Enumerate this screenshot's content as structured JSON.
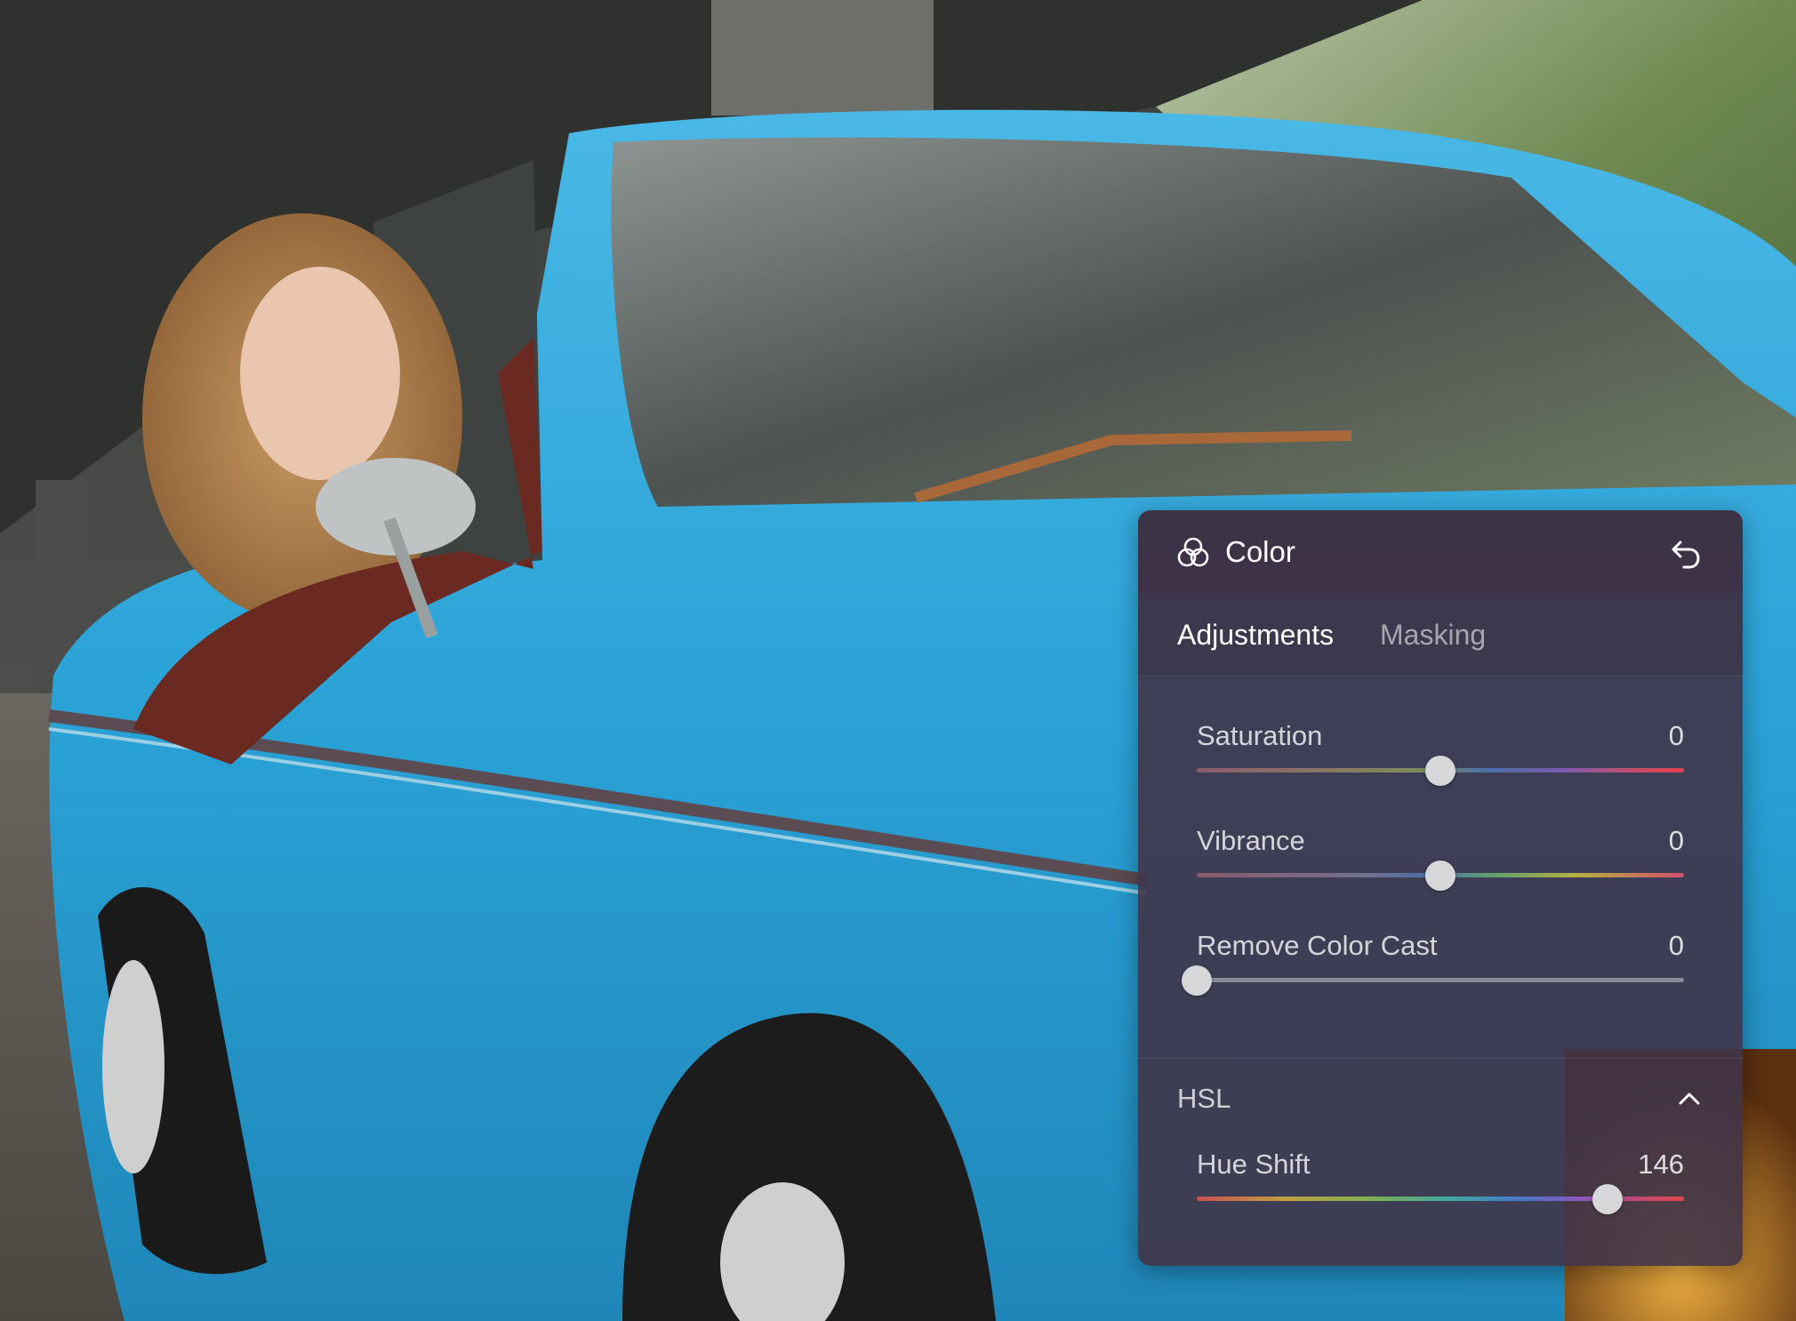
{
  "panel": {
    "title": "Color",
    "icon": "color-circles-icon",
    "undo_icon": "undo-icon",
    "tabs": [
      {
        "label": "Adjustments",
        "active": true
      },
      {
        "label": "Masking",
        "active": false
      }
    ],
    "sliders": [
      {
        "label": "Saturation",
        "value": "0",
        "position": 0.5
      },
      {
        "label": "Vibrance",
        "value": "0",
        "position": 0.5
      },
      {
        "label": "Remove Color Cast",
        "value": "0",
        "position": 0.0
      }
    ],
    "hsl": {
      "label": "HSL",
      "expanded": true,
      "chevron_icon": "chevron-up-icon",
      "sliders": [
        {
          "label": "Hue Shift",
          "value": "146",
          "position": 0.843
        }
      ]
    }
  },
  "colors": {
    "panel_bg": "#403448",
    "thumb": "#d7d7da",
    "car_blue": "#2fa6d6"
  }
}
